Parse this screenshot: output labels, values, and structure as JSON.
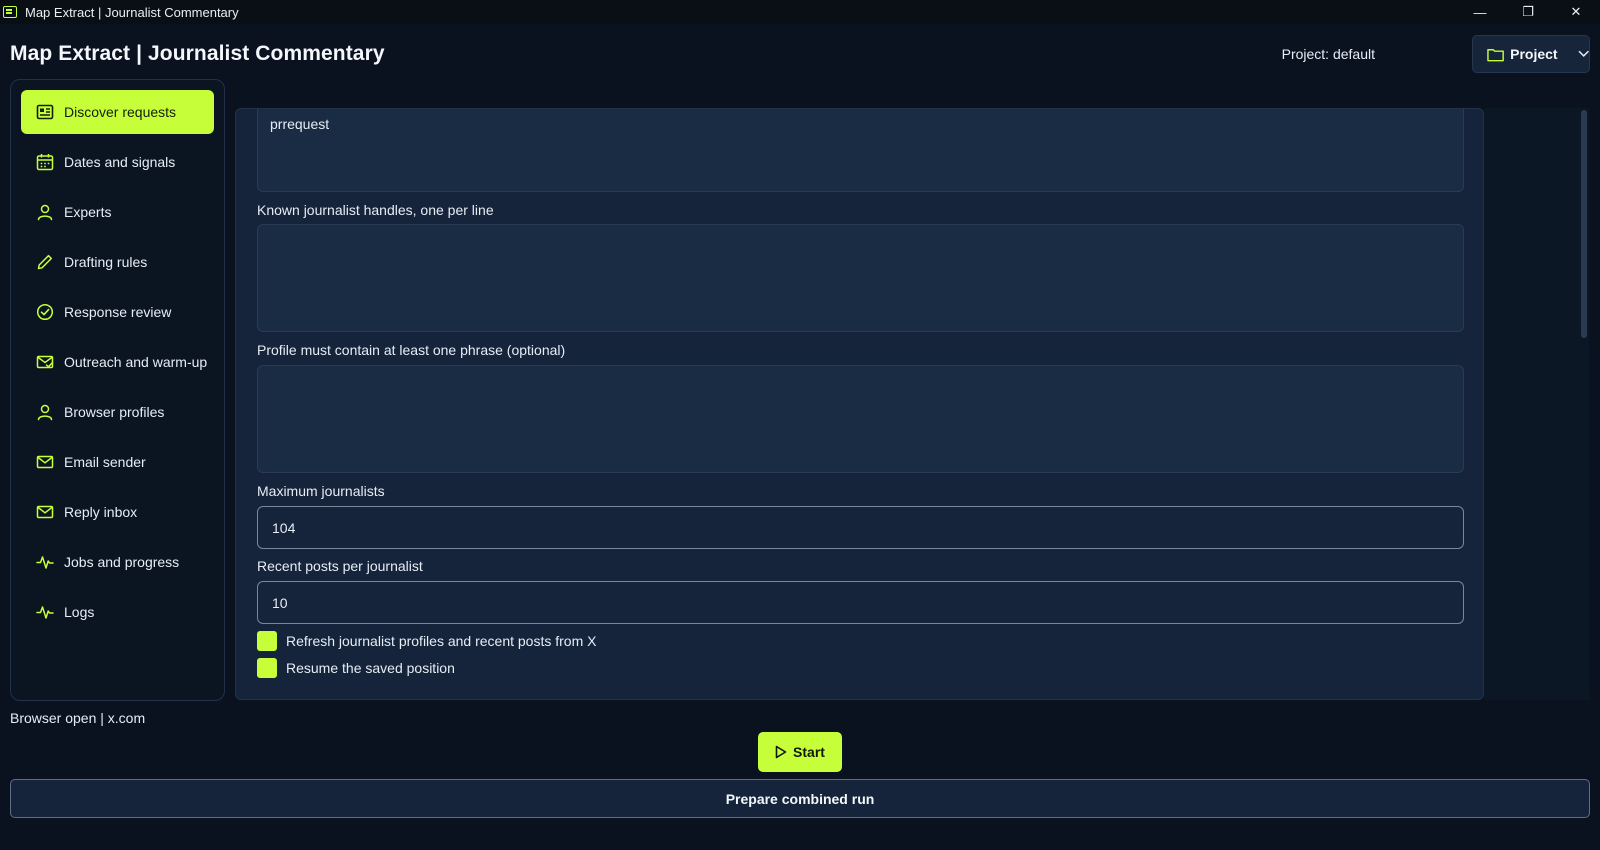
{
  "window": {
    "title": "Map Extract | Journalist Commentary",
    "controls": [
      "—",
      "❐",
      "✕"
    ]
  },
  "header": {
    "title": "Map Extract | Journalist Commentary",
    "project_label": "Project: default",
    "project_button": "Project"
  },
  "sidebar": {
    "items": [
      {
        "label": "Discover requests",
        "icon": "newspaper-icon",
        "active": true
      },
      {
        "label": "Dates and signals",
        "icon": "calendar-icon"
      },
      {
        "label": "Experts",
        "icon": "person-icon"
      },
      {
        "label": "Drafting rules",
        "icon": "pencil-icon"
      },
      {
        "label": "Response review",
        "icon": "check-circle-icon"
      },
      {
        "label": "Outreach and warm-up",
        "icon": "mail-check-icon"
      },
      {
        "label": "Browser profiles",
        "icon": "person-icon"
      },
      {
        "label": "Email sender",
        "icon": "mail-icon"
      },
      {
        "label": "Reply inbox",
        "icon": "mail-icon"
      },
      {
        "label": "Jobs and progress",
        "icon": "activity-icon"
      },
      {
        "label": "Logs",
        "icon": "activity-icon"
      }
    ]
  },
  "status": "Browser open | x.com",
  "form": {
    "top_textarea_value": "prrequest",
    "handles_label": "Known journalist handles, one per line",
    "handles_value": "",
    "phrase_label": "Profile must contain at least one phrase (optional)",
    "phrase_value": "",
    "max_journalists_label": "Maximum journalists",
    "max_journalists_value": "104",
    "recent_posts_label": "Recent posts per journalist",
    "recent_posts_value": "10",
    "refresh_label": "Refresh journalist profiles and recent posts from X",
    "resume_label": "Resume the saved position"
  },
  "actions": {
    "start": "Start",
    "combined": "Prepare combined run"
  },
  "colors": {
    "accent": "#c6ff3a",
    "background": "#0a1220",
    "panel": "#15243a"
  }
}
